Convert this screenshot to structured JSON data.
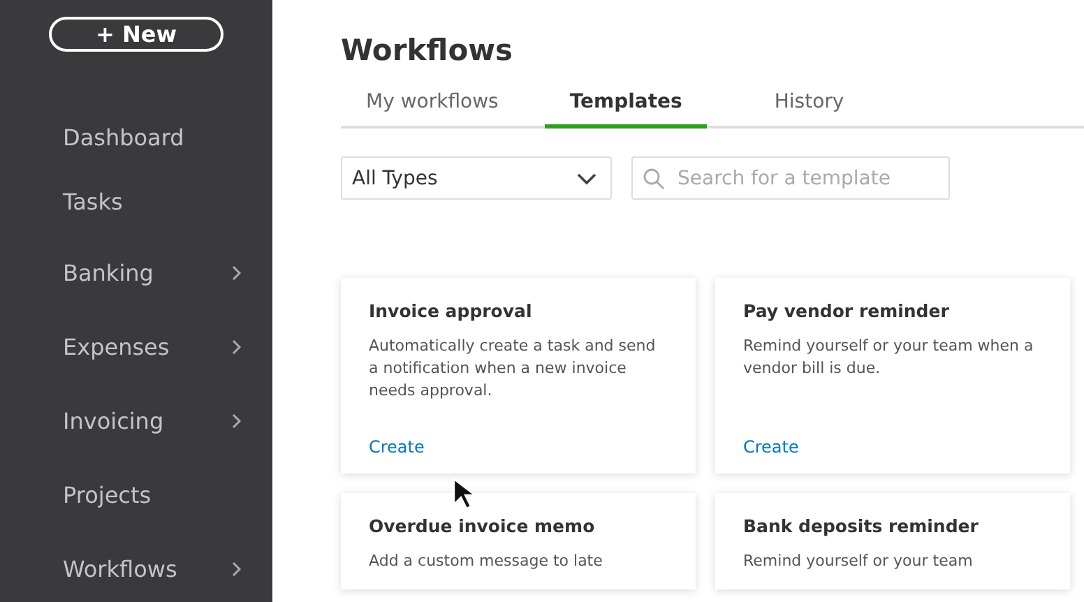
{
  "sidebar": {
    "new_button": "+ New",
    "items": [
      {
        "label": "Dashboard",
        "expandable": false
      },
      {
        "label": "Tasks",
        "expandable": false
      },
      {
        "label": "Banking",
        "expandable": true
      },
      {
        "label": "Expenses",
        "expandable": true
      },
      {
        "label": "Invoicing",
        "expandable": true
      },
      {
        "label": "Projects",
        "expandable": false
      },
      {
        "label": "Workflows",
        "expandable": true
      }
    ]
  },
  "page": {
    "title": "Workflows"
  },
  "tabs": [
    {
      "label": "My workflows",
      "selected": false
    },
    {
      "label": "Templates",
      "selected": true
    },
    {
      "label": "History",
      "selected": false
    }
  ],
  "type_filter": {
    "value": "All Types"
  },
  "search": {
    "placeholder": "Search for a template"
  },
  "templates": [
    {
      "title": "Invoice approval",
      "description": "Automatically create a task and send a notification when a new invoice needs approval.",
      "action": "Create"
    },
    {
      "title": "Pay vendor reminder",
      "description": "Remind yourself or your team when a vendor bill is due.",
      "action": "Create"
    },
    {
      "title": "Overdue invoice memo",
      "description": "Add a custom message to late"
    },
    {
      "title": "Bank deposits reminder",
      "description": "Remind yourself or your team"
    }
  ]
}
